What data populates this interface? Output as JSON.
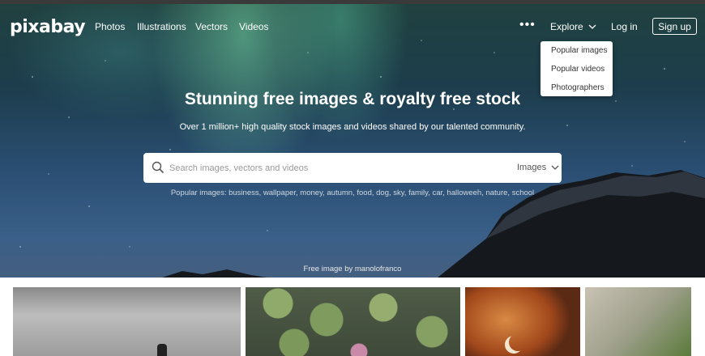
{
  "header": {
    "logo": "pixabay",
    "nav": [
      "Photos",
      "Illustrations",
      "Vectors",
      "Videos"
    ],
    "more": "•••",
    "explore": "Explore",
    "login": "Log in",
    "signup": "Sign up"
  },
  "explore_menu": [
    "Popular images",
    "Popular videos",
    "Photographers"
  ],
  "hero": {
    "headline": "Stunning free images & royalty free stock",
    "subline": "Over 1 million+ high quality stock images and videos shared by our talented community.",
    "search_placeholder": "Search images, vectors and videos",
    "search_type": "Images",
    "popular": "Popular images: business, wallpaper, money, autumn, food, dog, sky, family, car, halloween, nature, school",
    "credit": "Free image by manolofranco"
  },
  "icons": {
    "search": "search-icon",
    "chevron": "chevron-down-icon"
  },
  "colors": {
    "hero_sky": "#2a4e72",
    "aurora": "#78dcaa",
    "text": "#ffffff"
  }
}
